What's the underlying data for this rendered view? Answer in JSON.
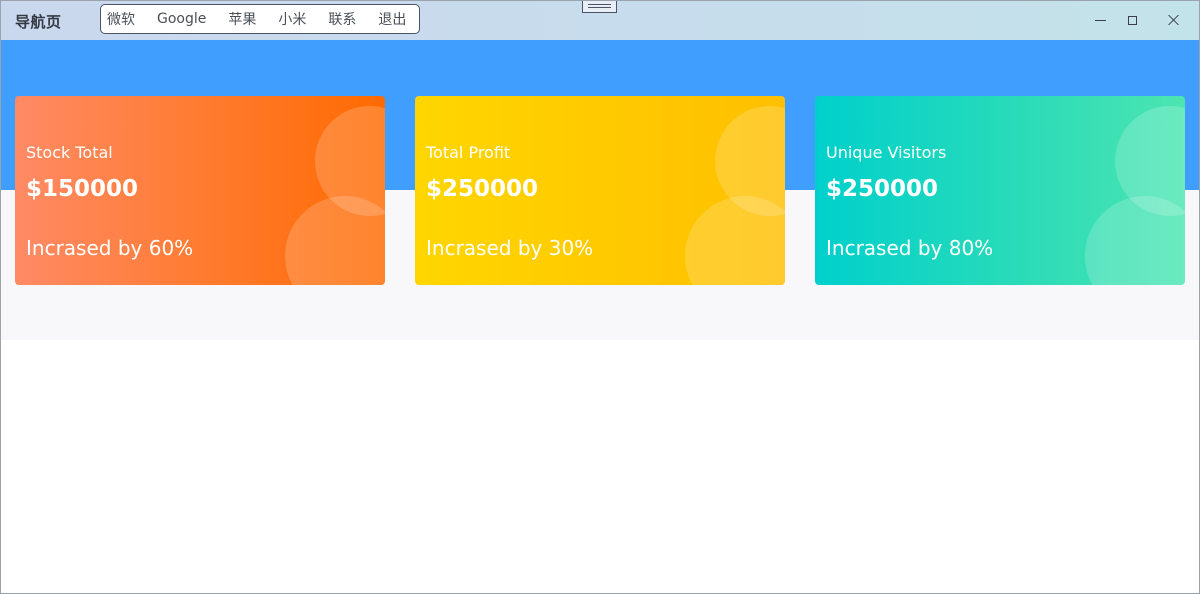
{
  "window": {
    "title": "导航页",
    "controls": {
      "minimize_icon": "minimize-icon",
      "maximize_icon": "maximize-icon",
      "close_icon": "close-icon"
    }
  },
  "nav": {
    "items": [
      {
        "label": "微软"
      },
      {
        "label": "Google"
      },
      {
        "label": "苹果"
      },
      {
        "label": "小米"
      },
      {
        "label": "联系"
      },
      {
        "label": "退出"
      }
    ]
  },
  "cards": [
    {
      "title": "Stock Total",
      "value": "$150000",
      "sub": "Incrased by 60%",
      "colors": [
        "#ff8a65",
        "#ff6a00"
      ]
    },
    {
      "title": "Total Profit",
      "value": "$250000",
      "sub": "Incrased by 30%",
      "colors": [
        "#ffd600",
        "#ffbf00"
      ]
    },
    {
      "title": "Unique Visitors",
      "value": "$250000",
      "sub": "Incrased by 80%",
      "colors": [
        "#00d0cc",
        "#4ce5b0"
      ]
    }
  ],
  "theme": {
    "header_band": "#409eff",
    "content_bg": "#f8f8fa"
  }
}
